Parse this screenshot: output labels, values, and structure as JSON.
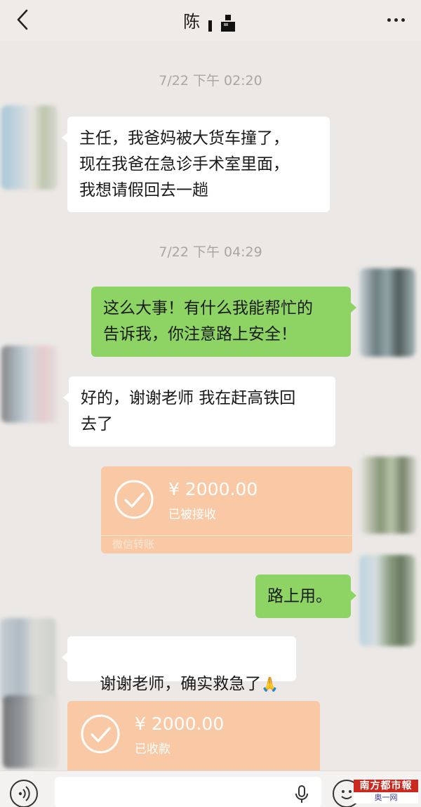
{
  "header": {
    "title": "陈",
    "back_icon": "chevron-left-icon",
    "more_icon": "more-dots-icon"
  },
  "messages": {
    "timestamp_1": "7/22 下午 02:20",
    "msg_1": "主任，我爸妈被大货车撞了，\n现在我爸在急诊手术室里面，\n我想请假回去一趟",
    "timestamp_2": "7/22 下午 04:29",
    "msg_2": "这么大事！有什么我能帮忙的\n告诉我，你注意路上安全！",
    "msg_3": "好的，谢谢老师 我在赶高铁回\n去了",
    "transfer_1": {
      "amount": "¥ 2000.00",
      "status": "已被接收",
      "footer": "微信转账"
    },
    "msg_4": "路上用。",
    "msg_5": "谢谢老师，确实救急了",
    "msg_5_emoji": "🙏",
    "transfer_2": {
      "amount": "¥ 2000.00",
      "status": "已收款"
    }
  },
  "input_bar": {
    "voice_icon": "voice-icon",
    "mic_icon": "microphone-icon",
    "emoji_icon": "emoji-icon"
  },
  "watermark": {
    "top": "南方都市報",
    "bottom": "奥一网 oeeee.com"
  },
  "colors": {
    "background": "#ebe8e5",
    "bubble_left": "#ffffff",
    "bubble_right": "#8ed464",
    "transfer_card": "#f8c9a4"
  }
}
